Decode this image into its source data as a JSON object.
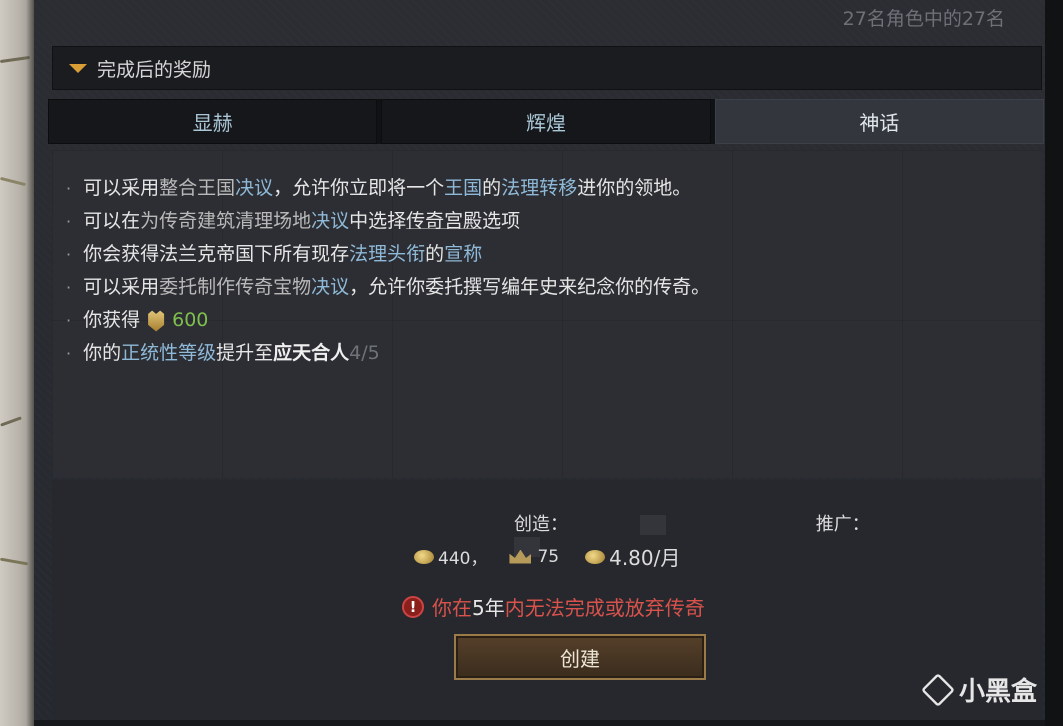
{
  "header": {
    "count_text": "27名角色中的27名"
  },
  "rewards_section": {
    "title": "完成后的奖励",
    "tabs": [
      {
        "label": "显赫",
        "active": false
      },
      {
        "label": "辉煌",
        "active": false
      },
      {
        "label": "神话",
        "active": true
      }
    ],
    "items": [
      {
        "parts": [
          "可以采用",
          "整合王国",
          "决议",
          "，允许你立即将一个",
          "王国",
          "的",
          "法理转移",
          "进你的领地。"
        ]
      },
      {
        "parts": [
          "可以在",
          "为传奇建筑清理场地",
          "决议",
          "中选择",
          "传奇宫殿",
          "选项"
        ]
      },
      {
        "parts": [
          "你会获得",
          "法兰克帝国",
          "下所有现存",
          "法理",
          "头衔",
          "的",
          "宣称"
        ]
      },
      {
        "parts": [
          "可以采用",
          "委托制作传奇宝物",
          "决议",
          "，允许你委托撰写编年史来纪念你的传奇。"
        ]
      },
      {
        "parts": [
          "你获得",
          "600"
        ],
        "icon": "prestige-icon"
      },
      {
        "parts": [
          "你的",
          "正统性等级",
          "提升至",
          "应天合人",
          "4/5"
        ]
      }
    ]
  },
  "cost": {
    "create_label": "创造：",
    "promote_label": "推广：",
    "gold_value": "440，",
    "prestige_value": "75",
    "monthly_value": "4.80/月",
    "icons": [
      "gold-coin-icon",
      "prestige-crown-icon",
      "gold-coin-icon"
    ]
  },
  "warning": {
    "icon": "exclamation-icon",
    "parts": [
      "你在",
      "5年",
      "内无法完成或放弃传奇"
    ]
  },
  "create_button": {
    "label": "创建"
  },
  "watermark": {
    "text": "小黑盒"
  },
  "colors": {
    "accent_gold": "#d99f36",
    "link_blue": "#8fb9d8",
    "warning_red": "#d9524c",
    "value_green": "#7fbf4d"
  }
}
